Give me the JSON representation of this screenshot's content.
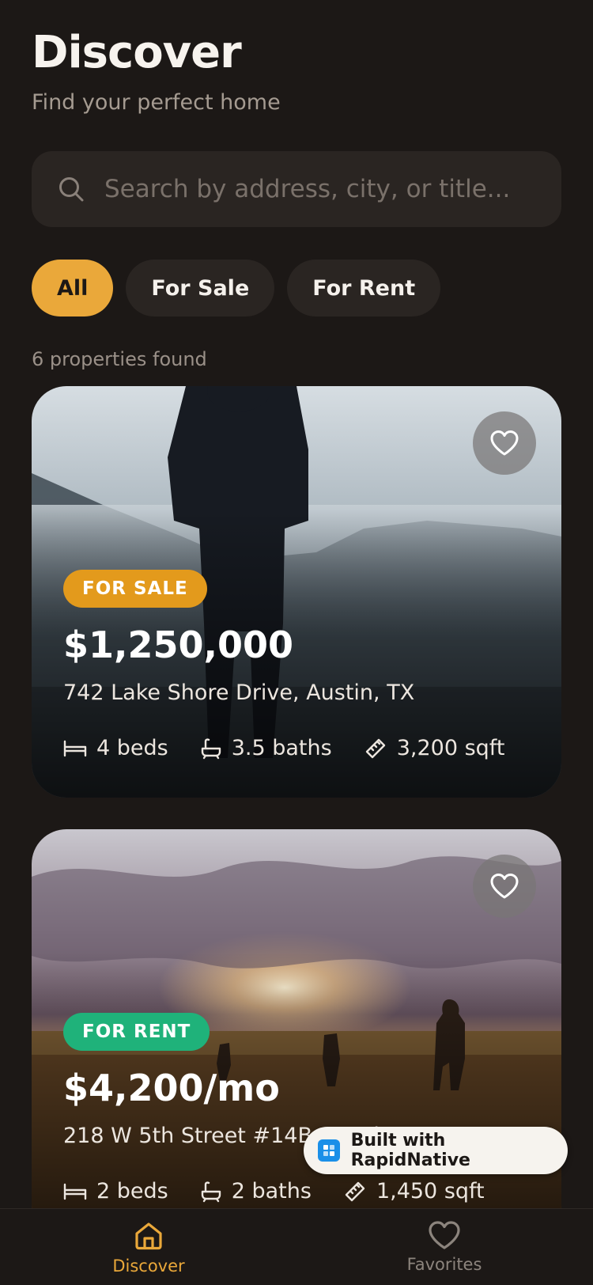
{
  "header": {
    "title": "Discover",
    "subtitle": "Find your perfect home"
  },
  "search": {
    "placeholder": "Search by address, city, or title...",
    "icon": "search-icon"
  },
  "filters": {
    "items": [
      {
        "label": "All",
        "active": true
      },
      {
        "label": "For Sale",
        "active": false
      },
      {
        "label": "For Rent",
        "active": false
      }
    ]
  },
  "results": {
    "count_text": "6 properties found"
  },
  "listings": [
    {
      "badge": "FOR SALE",
      "badge_color": "#e39a1c",
      "price": "$1,250,000",
      "address": "742 Lake Shore Drive, Austin, TX",
      "beds": "4 beds",
      "baths": "3.5 baths",
      "area": "3,200 sqft",
      "favorite_icon": "heart-icon"
    },
    {
      "badge": "FOR RENT",
      "badge_color": "#1fb27a",
      "price": "$4,200/mo",
      "address": "218 W 5th Street #14B, Austin, TX",
      "beds": "2 beds",
      "baths": "2 baths",
      "area": "1,450 sqft",
      "favorite_icon": "heart-icon"
    }
  ],
  "builder_badge": {
    "text": "Built with RapidNative"
  },
  "tabbar": {
    "items": [
      {
        "label": "Discover",
        "icon": "home-icon",
        "active": true
      },
      {
        "label": "Favorites",
        "icon": "heart-icon",
        "active": false
      }
    ]
  },
  "colors": {
    "background": "#1c1816",
    "accent": "#eaa83a",
    "sale": "#e39a1c",
    "rent": "#1fb27a"
  }
}
